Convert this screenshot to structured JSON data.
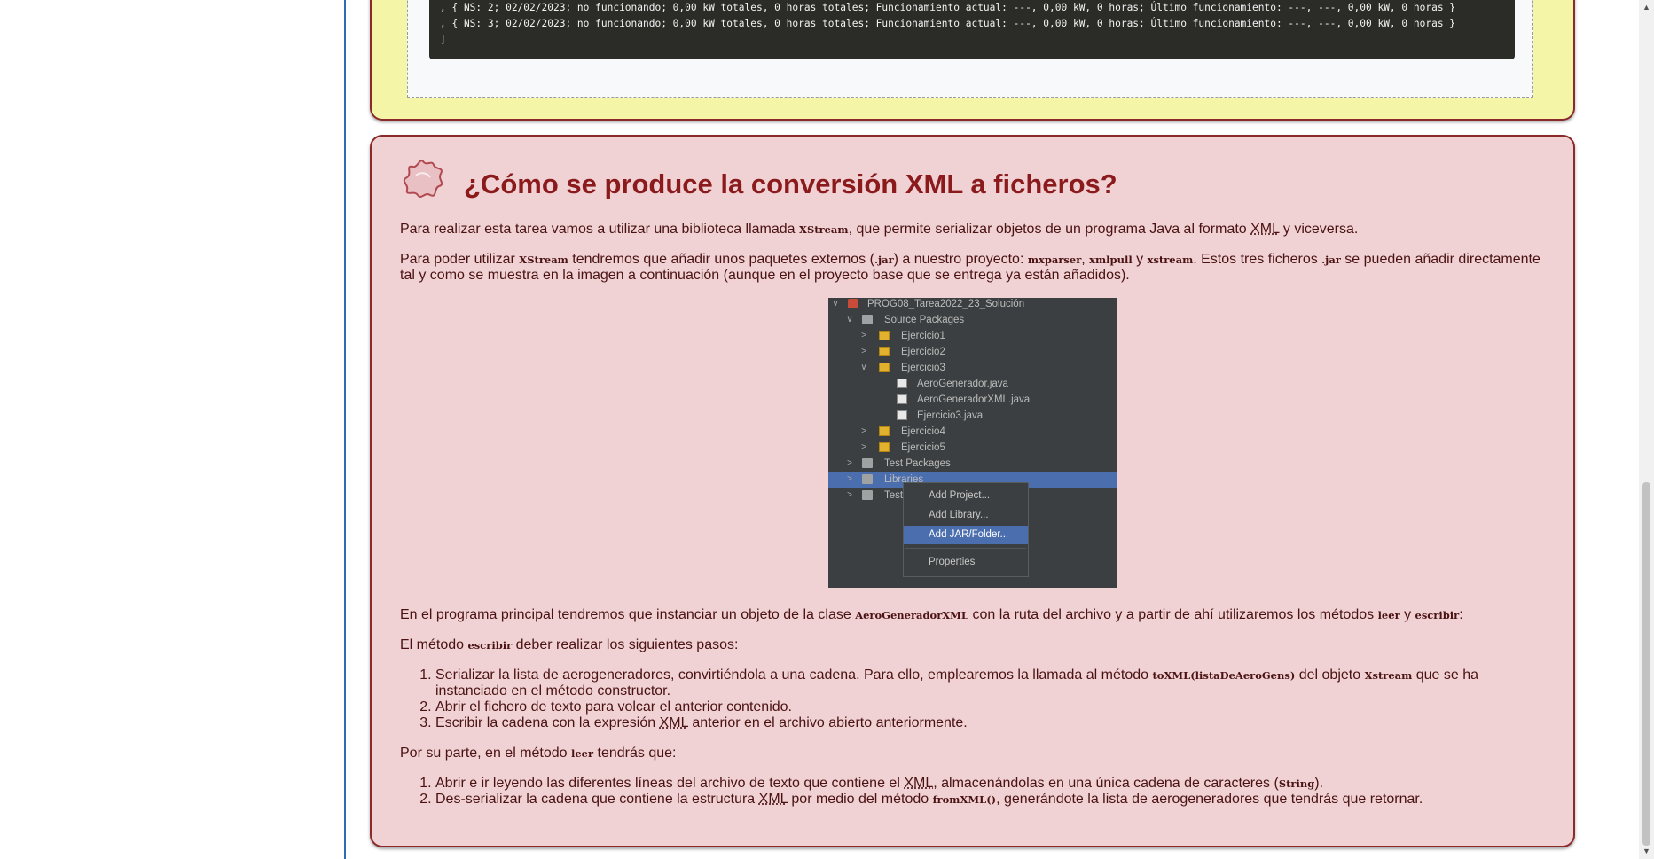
{
  "code": {
    "lines": [
      ", { NS: 2; 02/02/2023; no funcionando; 0,00 kW totales, 0 horas totales; Funcionamiento actual: ---, 0,00 kW, 0 horas; Último funcionamiento: ---, ---, 0,00 kW, 0 horas }",
      ", { NS: 3; 02/02/2023; no funcionando; 0,00 kW totales, 0 horas totales; Funcionamiento actual: ---, 0,00 kW, 0 horas; Último funcionamiento: ---, ---, 0,00 kW, 0 horas }",
      "]"
    ]
  },
  "section": {
    "icon": "splat-icon",
    "title": "¿Cómo se produce la conversión XML a ficheros?",
    "p1": {
      "a": "Para realizar esta tarea vamos a utilizar una biblioteca llamada ",
      "code": "XStream",
      "b": ", que permite serializar objetos de un programa Java al formato ",
      "abbr": "XML",
      "c": " y viceversa."
    },
    "p2": {
      "a": "Para poder utilizar ",
      "code1": "XStream",
      "b": " tendremos que añadir unos paquetes externos (",
      "code2": ".jar",
      "c": ") a nuestro proyecto: ",
      "code3": "mxparser",
      "d": ", ",
      "code4": "xmlpull",
      "e": " y ",
      "code5": "xstream",
      "f": ". Estos tres ficheros ",
      "code6": ".jar",
      "g": " se pueden añadir directamente tal y como se muestra en la imagen a continuación (aunque en el proyecto base que se entrega ya están añadidos)."
    },
    "ide": {
      "tree": [
        {
          "label": "PROG08_Tarea2022_23_Solución",
          "arrow": "∨",
          "icon": "project-icon"
        },
        {
          "label": "Source Packages",
          "arrow": "∨",
          "icon": "folder-icon"
        },
        {
          "label": "Ejercicio1",
          "arrow": ">",
          "icon": "package-icon"
        },
        {
          "label": "Ejercicio2",
          "arrow": ">",
          "icon": "package-icon"
        },
        {
          "label": "Ejercicio3",
          "arrow": "∨",
          "icon": "package-icon"
        },
        {
          "label": "AeroGenerador.java",
          "arrow": "",
          "icon": "java-file-icon"
        },
        {
          "label": "AeroGeneradorXML.java",
          "arrow": "",
          "icon": "java-file-icon"
        },
        {
          "label": "Ejercicio3.java",
          "arrow": "",
          "icon": "java-file-icon"
        },
        {
          "label": "Ejercicio4",
          "arrow": ">",
          "icon": "package-icon"
        },
        {
          "label": "Ejercicio5",
          "arrow": ">",
          "icon": "package-icon"
        },
        {
          "label": "Test Packages",
          "arrow": ">",
          "icon": "folder-icon"
        },
        {
          "label": "Libraries",
          "arrow": ">",
          "icon": "library-icon"
        },
        {
          "label": "Test Libraries",
          "arrow": ">",
          "icon": "library-icon"
        }
      ],
      "menu": [
        "Add Project...",
        "Add Library...",
        "Add JAR/Folder...",
        "Properties"
      ]
    },
    "p3": {
      "a": "En el programa principal tendremos que instanciar un objeto de la clase ",
      "code1": "AeroGeneradorXML",
      "b": " con la ruta del archivo y a partir de ahí utilizaremos los métodos ",
      "code2": "leer",
      "c": " y ",
      "code3": "escribir",
      "d": ":"
    },
    "p4": {
      "a": "El método ",
      "code": "escribir",
      "b": " deber realizar los siguientes pasos:"
    },
    "list1": {
      "i1a": "Serializar la lista de aerogeneradores, convirtiéndola a una cadena. Para ello, emplearemos la llamada al método ",
      "i1code1": "toXML(listaDeAeroGens)",
      "i1b": " del objeto ",
      "i1code2": "Xstream",
      "i1c": " que se ha instanciado en el método constructor.",
      "i2": "Abrir el fichero de texto para volcar el anterior contenido.",
      "i3a": "Escribir la cadena con la expresión ",
      "i3abbr": "XML",
      "i3b": " anterior en el archivo abierto anteriormente."
    },
    "p5": {
      "a": "Por su parte, en el método ",
      "code": "leer",
      "b": " tendrás que:"
    },
    "list2": {
      "i1a": "Abrir e ir leyendo las diferentes líneas del archivo de texto que contiene el  ",
      "i1abbr": "XML",
      "i1b": ", almacenándolas en una única cadena de caracteres (",
      "i1code": "String",
      "i1c": ").",
      "i2a": "Des-serializar la cadena que contiene la estructura ",
      "i2abbr": "XML",
      "i2b": " por medio del método ",
      "i2code": "fromXML()",
      "i2c": ", generándote la lista de aerogeneradores que tendrás que retornar."
    }
  }
}
